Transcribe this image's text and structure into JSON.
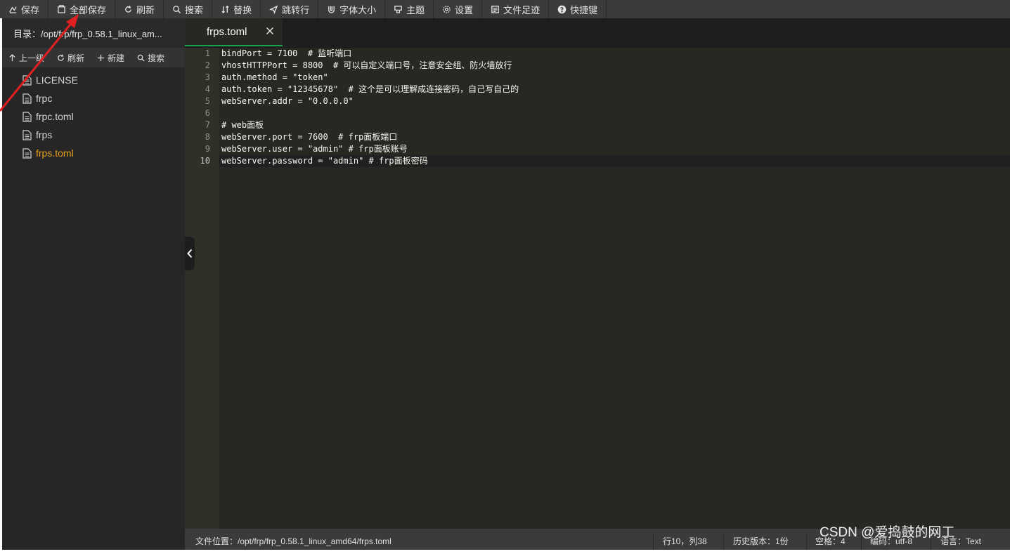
{
  "toolbar": {
    "buttons": [
      {
        "label": "保存",
        "icon": "save-icon"
      },
      {
        "label": "全部保存",
        "icon": "save-all-icon"
      },
      {
        "label": "刷新",
        "icon": "refresh-icon"
      },
      {
        "label": "搜索",
        "icon": "search-icon"
      },
      {
        "label": "替换",
        "icon": "replace-icon"
      },
      {
        "label": "跳转行",
        "icon": "jump-icon"
      },
      {
        "label": "字体大小",
        "icon": "font-size-icon"
      },
      {
        "label": "主题",
        "icon": "theme-icon"
      },
      {
        "label": "设置",
        "icon": "gear-icon"
      },
      {
        "label": "文件足迹",
        "icon": "history-icon"
      },
      {
        "label": "快捷键",
        "icon": "help-icon"
      }
    ]
  },
  "sidebar": {
    "dir_label": "目录：/opt/frp/frp_0.58.1_linux_am...",
    "actions": [
      {
        "label": "上一级",
        "icon": "arrow-up-icon"
      },
      {
        "label": "刷新",
        "icon": "refresh-icon"
      },
      {
        "label": "新建",
        "icon": "plus-icon"
      },
      {
        "label": "搜索",
        "icon": "search-icon"
      }
    ],
    "files": [
      {
        "name": "LICENSE",
        "active": false
      },
      {
        "name": "frpc",
        "active": false
      },
      {
        "name": "frpc.toml",
        "active": false
      },
      {
        "name": "frps",
        "active": false
      },
      {
        "name": "frps.toml",
        "active": true
      }
    ]
  },
  "editor": {
    "tab_label": "frps.toml",
    "current_line": 10,
    "lines": [
      {
        "num": "1",
        "text": "bindPort = 7100  # 监听端口"
      },
      {
        "num": "2",
        "text": "vhostHTTPPort = 8800  # 可以自定义端口号，注意安全组、防火墙放行"
      },
      {
        "num": "3",
        "text": "auth.method = \"token\""
      },
      {
        "num": "4",
        "text": "auth.token = \"12345678\"  # 这个是可以理解成连接密码，自己写自己的"
      },
      {
        "num": "5",
        "text": "webServer.addr = \"0.0.0.0\""
      },
      {
        "num": "6",
        "text": ""
      },
      {
        "num": "7",
        "text": "# web面板"
      },
      {
        "num": "8",
        "text": "webServer.port = 7600  # frp面板端口"
      },
      {
        "num": "9",
        "text": "webServer.user = \"admin\" # frp面板账号"
      },
      {
        "num": "10",
        "text": "webServer.password = \"admin\" # frp面板密码"
      }
    ]
  },
  "statusbar": {
    "file_path": "文件位置：/opt/frp/frp_0.58.1_linux_amd64/frps.toml",
    "cursor": "行10，列38",
    "history": "历史版本：1份",
    "indent": "空格：4",
    "encoding": "编码：utf-8",
    "language": "语言：Text"
  },
  "watermark": "CSDN @爱捣鼓的网工",
  "colors": {
    "toolbar_bg": "#3b3b3b",
    "sidebar_bg": "#262626",
    "editor_bg": "#272822",
    "active_file": "#e3a21a",
    "tab_underline": "#1aa34a",
    "annotation_arrow": "#e02020"
  }
}
